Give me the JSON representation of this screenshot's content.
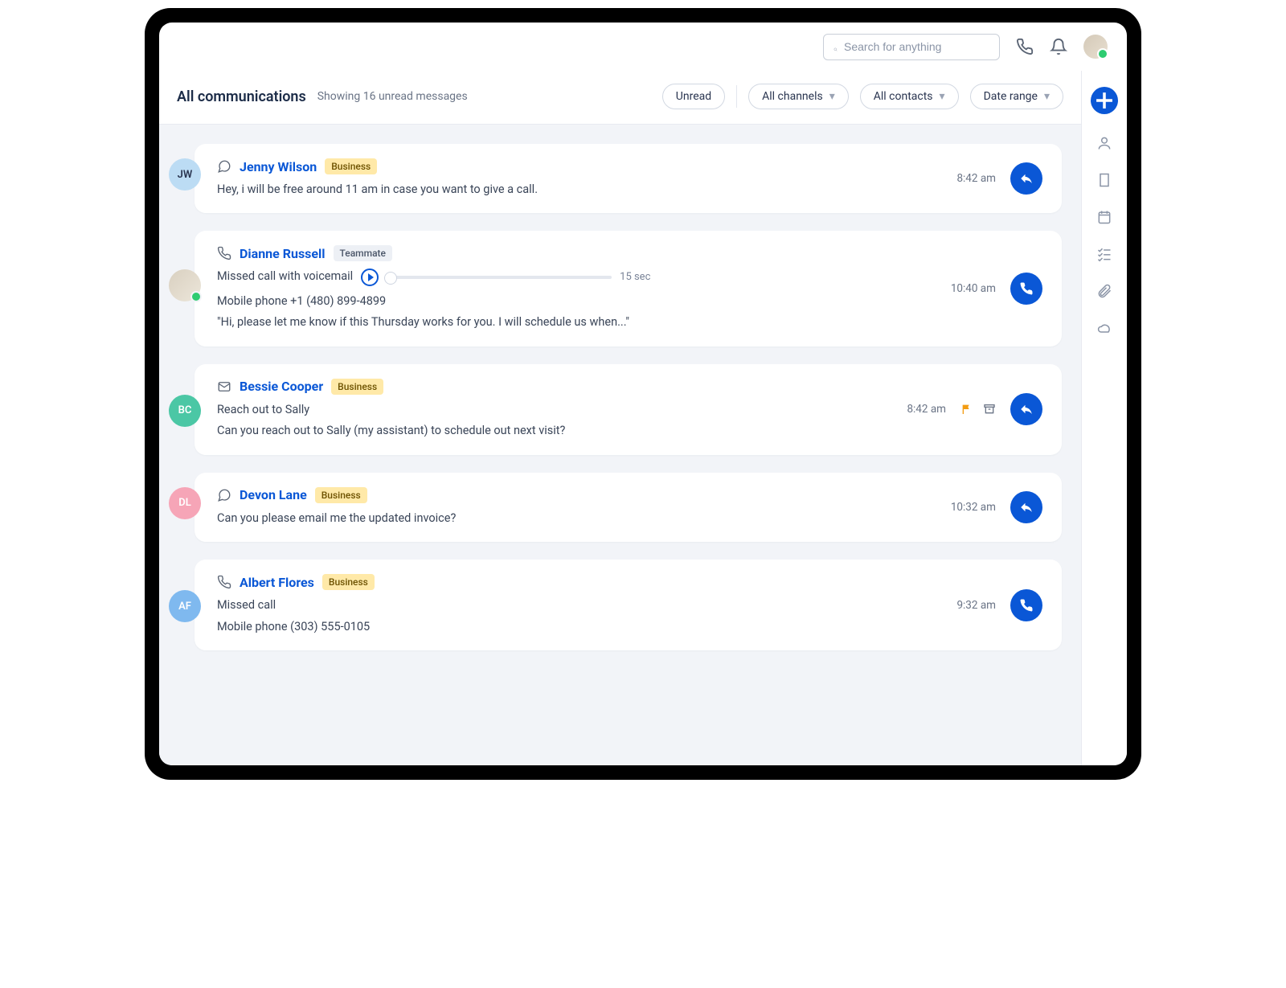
{
  "header": {
    "search_placeholder": "Search for anything"
  },
  "subheader": {
    "title": "All communications",
    "caption": "Showing 16 unread messages",
    "filters": {
      "unread": "Unread",
      "channels": "All channels",
      "contacts": "All contacts",
      "date_range": "Date range"
    }
  },
  "messages": [
    {
      "avatar": {
        "type": "initials",
        "text": "JW",
        "bg": "#bcdcf4",
        "fg": "#2a3550"
      },
      "icon": "chat",
      "name": "Jenny Wilson",
      "badge": {
        "label": "Business",
        "kind": "business"
      },
      "lines": [
        "Hey, i will be free around 11 am in case you want to give a call."
      ],
      "time": "8:42 am",
      "action": "reply"
    },
    {
      "avatar": {
        "type": "photo"
      },
      "icon": "phone",
      "name": "Dianne Russell",
      "badge": {
        "label": "Teammate",
        "kind": "teammate"
      },
      "voicemail": {
        "label": "Missed call with voicemail",
        "duration": "15 sec"
      },
      "lines": [
        "Mobile phone +1 (480) 899-4899",
        "\"Hi, please let me know if this Thursday works for you. I will schedule us when...\""
      ],
      "time": "10:40 am",
      "action": "call"
    },
    {
      "avatar": {
        "type": "initials",
        "text": "BC",
        "bg": "#4bc7a5",
        "fg": "#fff"
      },
      "icon": "mail",
      "name": "Bessie Cooper",
      "badge": {
        "label": "Business",
        "kind": "business"
      },
      "lines": [
        "Reach out to Sally",
        "Can you reach out to Sally (my assistant) to schedule out next visit?"
      ],
      "time": "8:42 am",
      "mini_icons": [
        "flag",
        "archive"
      ],
      "action": "reply"
    },
    {
      "avatar": {
        "type": "initials",
        "text": "DL",
        "bg": "#f6a5b7",
        "fg": "#fff"
      },
      "icon": "chat",
      "name": "Devon Lane",
      "badge": {
        "label": "Business",
        "kind": "business"
      },
      "lines": [
        "Can you please email me the updated invoice?"
      ],
      "time": "10:32 am",
      "action": "reply"
    },
    {
      "avatar": {
        "type": "initials",
        "text": "AF",
        "bg": "#7fb9ef",
        "fg": "#fff"
      },
      "icon": "phone",
      "name": "Albert Flores",
      "badge": {
        "label": "Business",
        "kind": "business"
      },
      "lines": [
        "Missed call",
        "Mobile phone (303) 555-0105"
      ],
      "time": "9:32 am",
      "action": "call"
    }
  ],
  "rail_icons": [
    "person",
    "building",
    "calendar",
    "checklist",
    "attachment",
    "cloud"
  ]
}
